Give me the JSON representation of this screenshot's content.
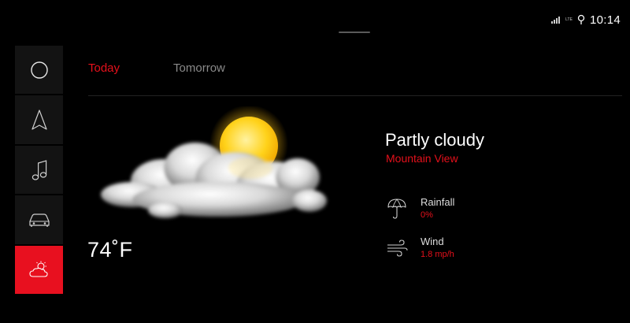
{
  "status_bar": {
    "network": "LTE",
    "time": "10:14",
    "icons": [
      "signal-icon",
      "location-pin-icon"
    ]
  },
  "sidebar": {
    "items": [
      {
        "id": "home",
        "icon": "circle-icon",
        "active": false
      },
      {
        "id": "navigation",
        "icon": "navigation-arrow-icon",
        "active": false
      },
      {
        "id": "media",
        "icon": "music-note-icon",
        "active": false
      },
      {
        "id": "vehicle",
        "icon": "car-icon",
        "active": false
      },
      {
        "id": "weather",
        "icon": "weather-icon",
        "active": true
      }
    ]
  },
  "tabs": [
    {
      "label": "Today",
      "active": true
    },
    {
      "label": "Tomorrow",
      "active": false
    }
  ],
  "weather": {
    "temperature": "74˚F",
    "condition": "Partly cloudy",
    "location": "Mountain View",
    "image": "partly-cloudy-icon"
  },
  "details": {
    "rainfall": {
      "label": "Rainfall",
      "value": "0%",
      "icon": "umbrella-icon"
    },
    "wind": {
      "label": "Wind",
      "value": "1.8 mp/h",
      "icon": "wind-icon"
    }
  },
  "colors": {
    "accent": "#e5101b",
    "sidebar_bg": "#131313",
    "inactive_text": "#8a8a8a"
  }
}
